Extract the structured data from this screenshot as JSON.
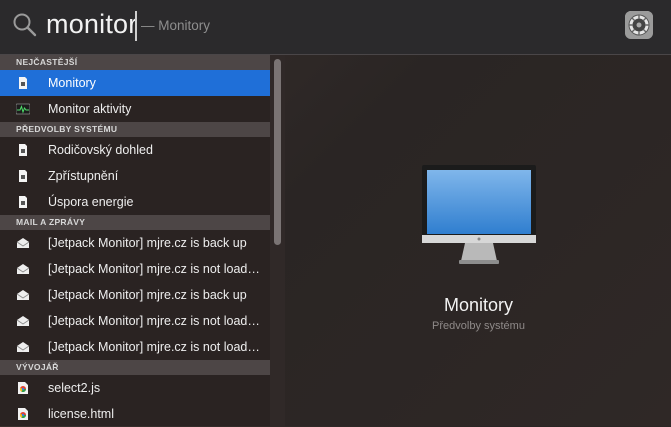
{
  "search": {
    "query": "monitor",
    "suggestion": "— Monitory"
  },
  "sections": [
    {
      "title": "NEJČASTĚJŠÍ",
      "items": [
        {
          "label": "Monitory",
          "icon": "prefpane-icon",
          "selected": true
        },
        {
          "label": "Monitor aktivity",
          "icon": "activity-monitor-icon"
        }
      ]
    },
    {
      "title": "PŘEDVOLBY SYSTÉMU",
      "items": [
        {
          "label": "Rodičovský dohled",
          "icon": "prefpane-icon"
        },
        {
          "label": "Zpřístupnění",
          "icon": "prefpane-icon"
        },
        {
          "label": "Úspora energie",
          "icon": "prefpane-icon"
        }
      ]
    },
    {
      "title": "MAIL A ZPRÁVY",
      "items": [
        {
          "label": "[Jetpack Monitor] mjre.cz is back up",
          "icon": "mail-icon"
        },
        {
          "label": "[Jetpack Monitor] mjre.cz is not loading",
          "icon": "mail-icon"
        },
        {
          "label": "[Jetpack Monitor] mjre.cz is back up",
          "icon": "mail-icon"
        },
        {
          "label": "[Jetpack Monitor] mjre.cz is not loading",
          "icon": "mail-icon"
        },
        {
          "label": "[Jetpack Monitor] mjre.cz is not loading",
          "icon": "mail-icon"
        }
      ]
    },
    {
      "title": "VÝVOJÁŘ",
      "items": [
        {
          "label": "select2.js",
          "icon": "chrome-doc-icon"
        },
        {
          "label": "license.html",
          "icon": "chrome-doc-icon"
        }
      ]
    }
  ],
  "preview": {
    "title": "Monitory",
    "subtitle": "Předvolby systému",
    "icon": "display-icon"
  },
  "colors": {
    "selection": "#1f6fd8",
    "section_bg": "#4d4646"
  }
}
